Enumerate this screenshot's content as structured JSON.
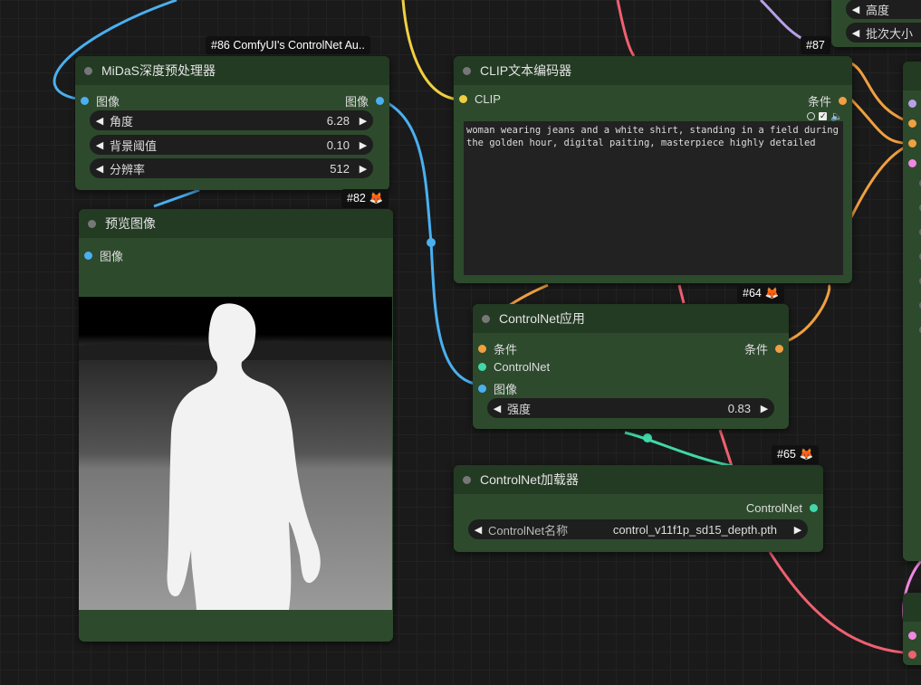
{
  "colors": {
    "canvas": "#1a1a1a",
    "node_bg": "#2d4a2d",
    "node_title": "#233a23",
    "image_link": "#4ab0f0",
    "conditioning_link": "#f0a040",
    "clip_link": "#f0d040",
    "controlnet_link": "#40d8a8"
  },
  "nodes": {
    "midas": {
      "id": "#86 ComfyUI's ControlNet Au..",
      "title": "MiDaS深度预处理器",
      "input": "图像",
      "output": "图像",
      "widgets": [
        {
          "label": "角度",
          "value": "6.28"
        },
        {
          "label": "背景阈值",
          "value": "0.10"
        },
        {
          "label": "分辨率",
          "value": "512"
        }
      ]
    },
    "preview": {
      "id": "#82",
      "title": "预览图像",
      "input": "图像"
    },
    "clip": {
      "id": "#87",
      "title": "CLIP文本编码器",
      "input": "CLIP",
      "output": "条件",
      "text": "woman wearing jeans and a white shirt, standing in a field during the golden hour, digital paiting, masterpiece highly detailed"
    },
    "apply": {
      "id": "#64",
      "title": "ControlNet应用",
      "inputs": [
        "条件",
        "ControlNet",
        "图像"
      ],
      "output": "条件",
      "widget": {
        "label": "强度",
        "value": "0.83"
      }
    },
    "loader": {
      "id": "#65",
      "title": "ControlNet加载器",
      "output": "ControlNet",
      "widget": {
        "label": "ControlNet名称",
        "value": "control_v11f1p_sd15_depth.pth"
      }
    },
    "partial": {
      "widgets": [
        "高度",
        "批次大小"
      ]
    }
  }
}
